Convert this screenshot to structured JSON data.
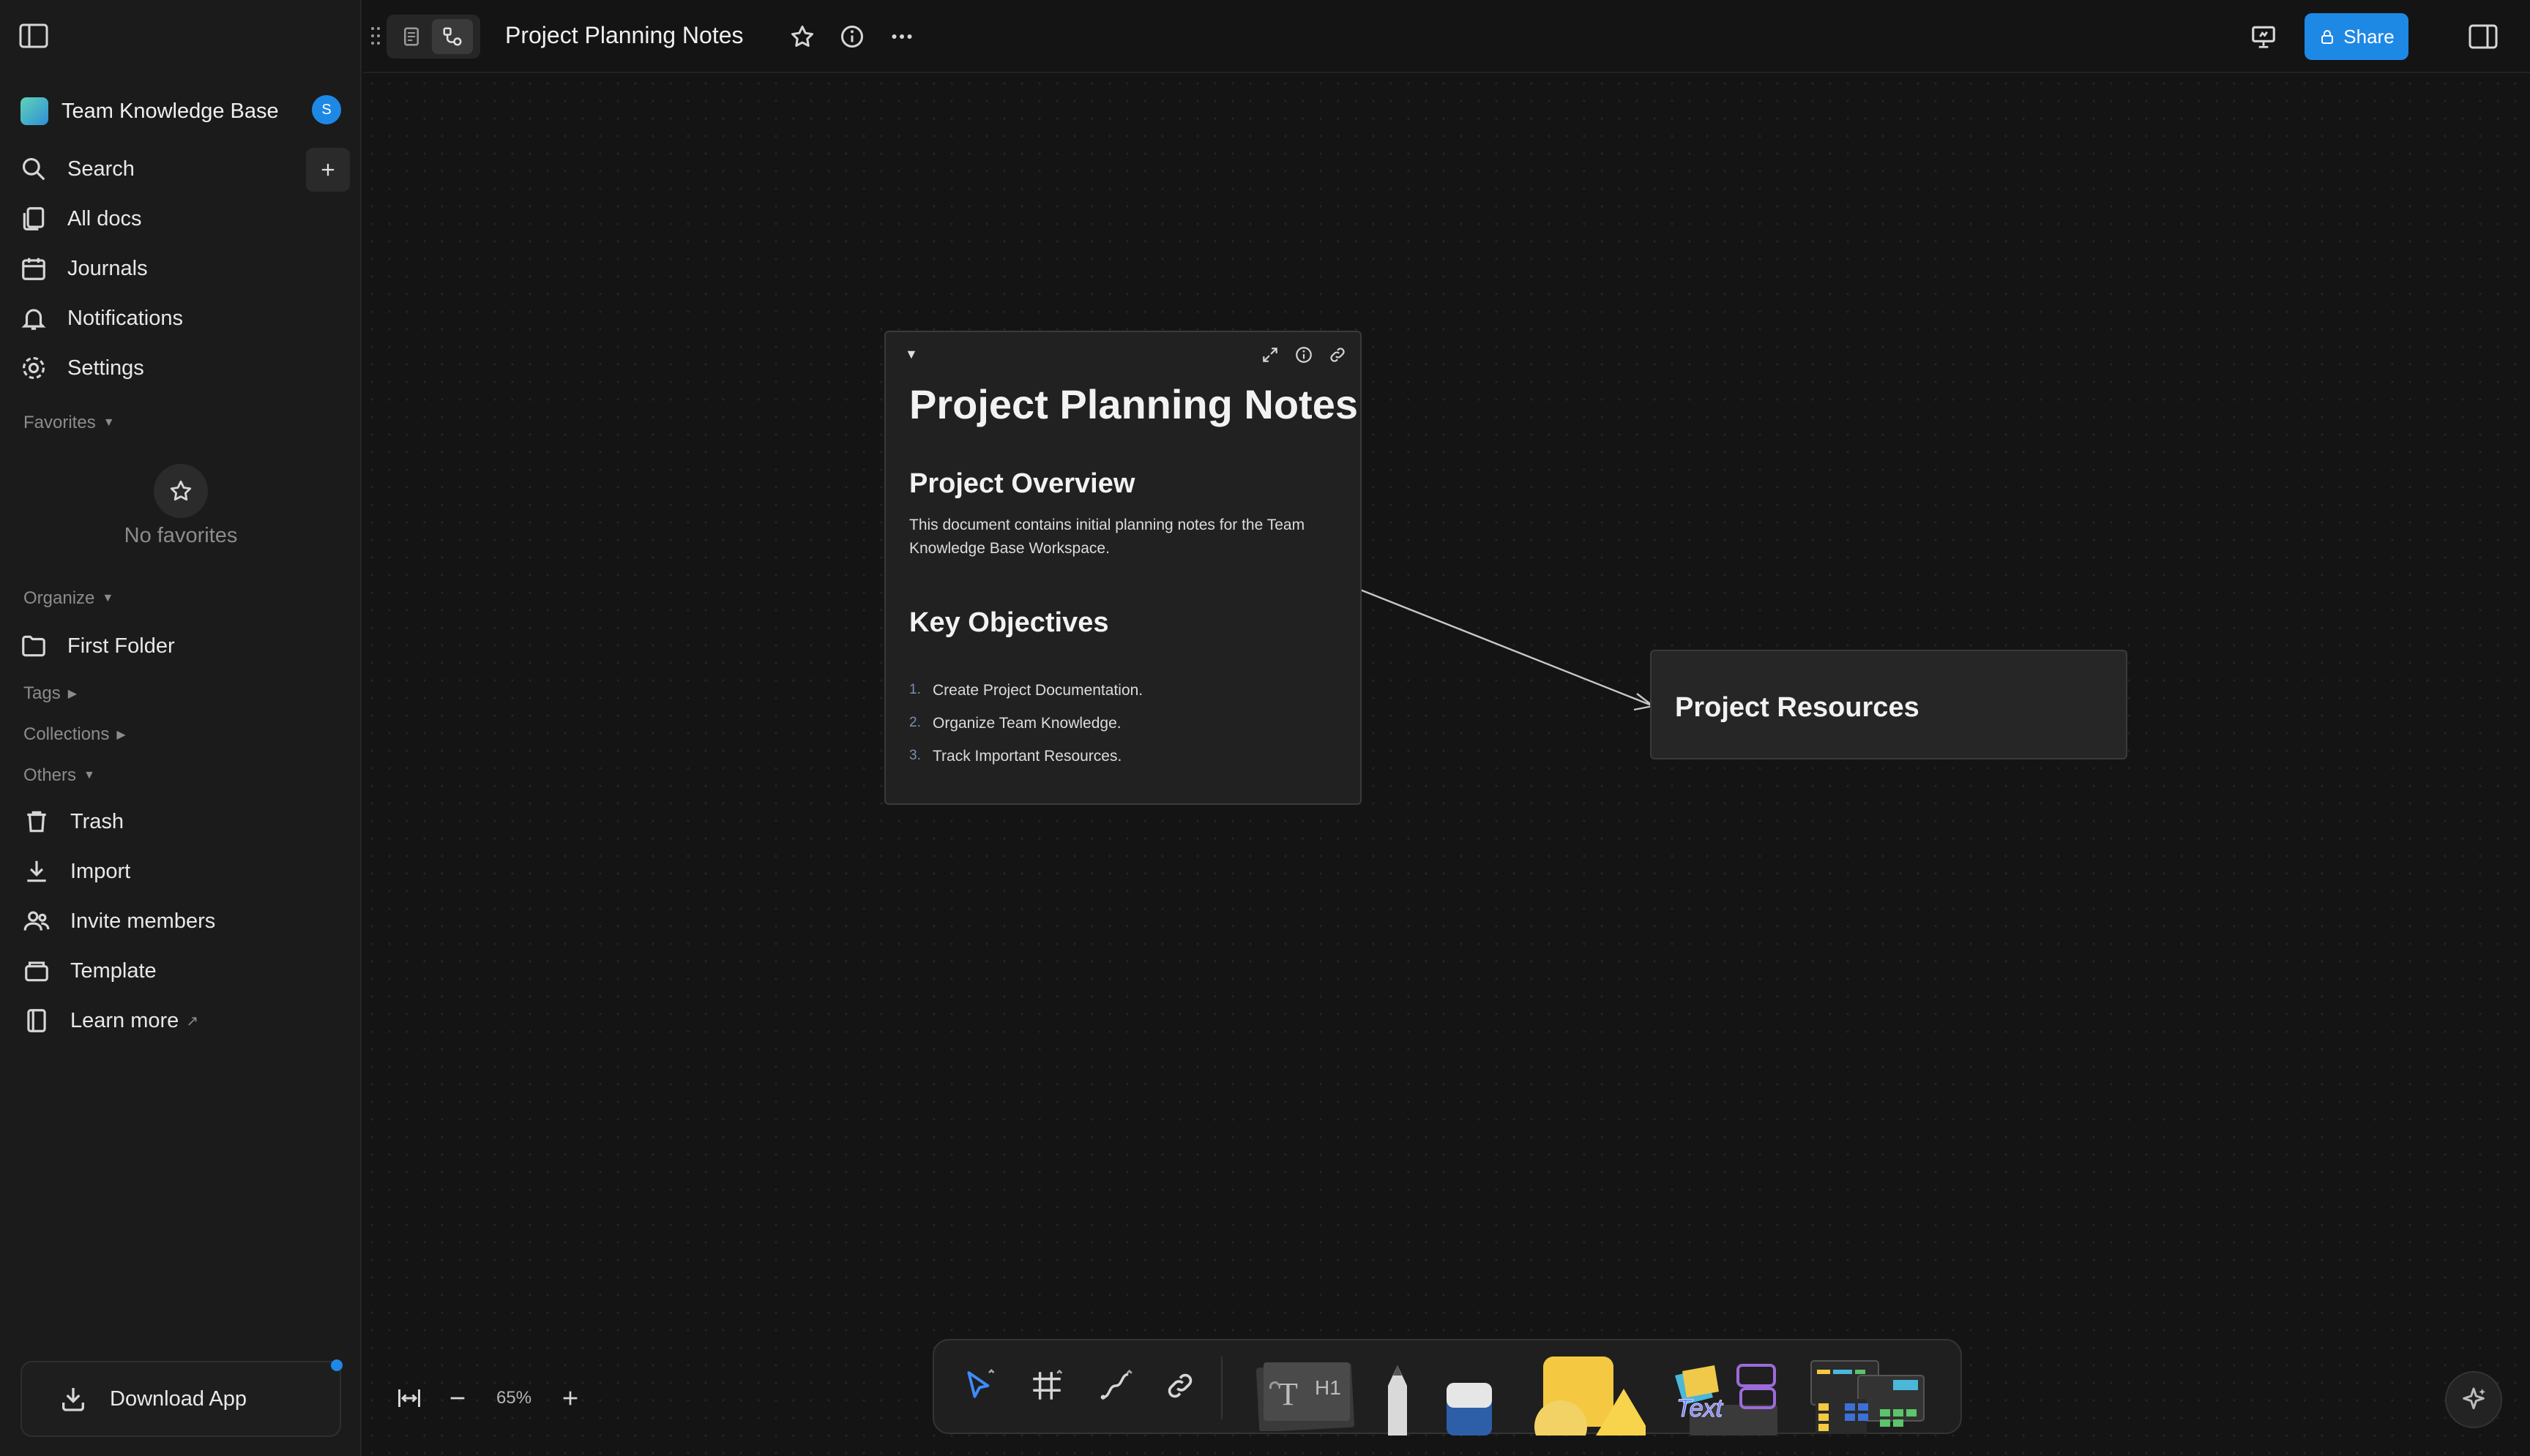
{
  "sidebar": {
    "workspace_name": "Team Knowledge Base",
    "avatar_letter": "S",
    "nav": {
      "search": "Search",
      "all_docs": "All docs",
      "journals": "Journals",
      "notifications": "Notifications",
      "settings": "Settings"
    },
    "sections": {
      "favorites": "Favorites",
      "organize": "Organize",
      "tags": "Tags",
      "collections": "Collections",
      "others": "Others"
    },
    "no_favorites": "No favorites",
    "folder": "First Folder",
    "others": {
      "trash": "Trash",
      "import": "Import",
      "invite": "Invite members",
      "template": "Template",
      "learn_more": "Learn more"
    },
    "download_app": "Download App"
  },
  "topbar": {
    "title": "Project Planning Notes",
    "share": "Share"
  },
  "canvas": {
    "note": {
      "title": "Project Planning Notes",
      "h_overview": "Project Overview",
      "overview_text": "This document contains initial planning notes for the Team Knowledge Base Workspace.",
      "h_objectives": "Key Objectives",
      "objectives": [
        {
          "num": "1.",
          "text": "Create Project Documentation."
        },
        {
          "num": "2.",
          "text": "Organize Team Knowledge."
        },
        {
          "num": "3.",
          "text": "Track Important Resources."
        }
      ]
    },
    "resource_card": "Project Resources",
    "zoom": "65%"
  },
  "colors": {
    "accent": "#1e88e5",
    "background": "#141414",
    "sidebar": "#1b1b1b",
    "card": "#212121"
  }
}
